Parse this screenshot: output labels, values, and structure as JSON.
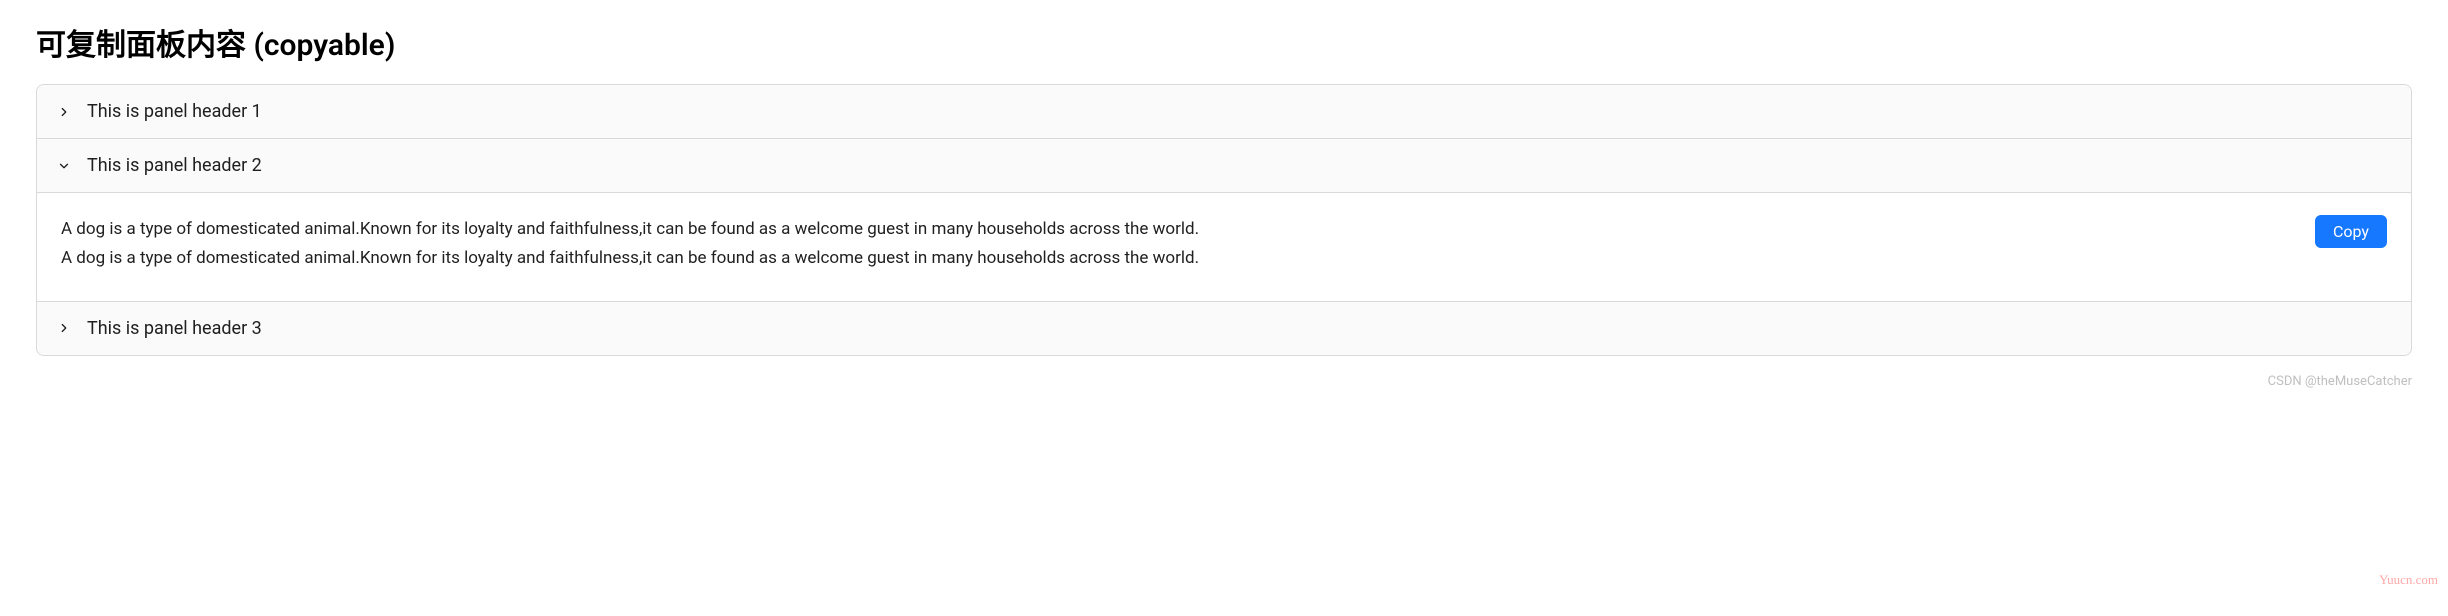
{
  "title": "可复制面板内容 (copyable)",
  "panels": [
    {
      "header": "This is panel header 1",
      "expanded": false
    },
    {
      "header": "This is panel header 2",
      "expanded": true,
      "content_line1": "A dog is a type of domesticated animal.Known for its loyalty and faithfulness,it can be found as a welcome guest in many households across the world.",
      "content_line2": "A dog is a type of domesticated animal.Known for its loyalty and faithfulness,it can be found as a welcome guest in many households across the world.",
      "copy_label": "Copy"
    },
    {
      "header": "This is panel header 3",
      "expanded": false
    }
  ],
  "footer_credit": "CSDN @theMuseCatcher",
  "watermark": "Yuucn.com"
}
